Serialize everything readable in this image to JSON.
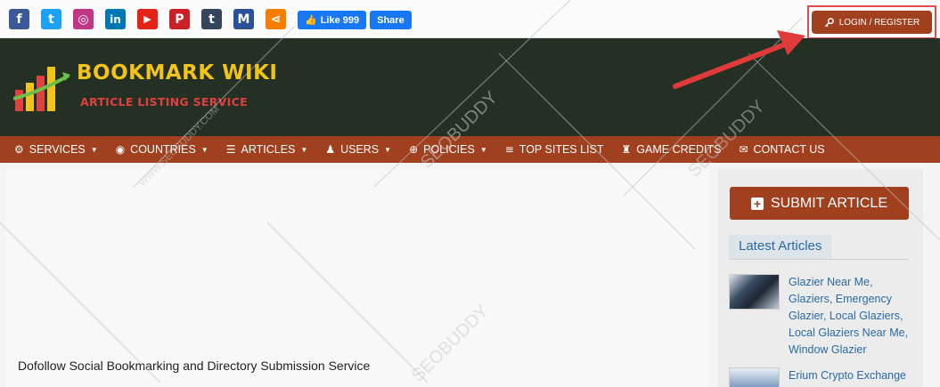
{
  "social_icons": [
    {
      "name": "facebook-icon",
      "glyph": "f",
      "color": "#3b5998"
    },
    {
      "name": "twitter-icon",
      "glyph": "t",
      "color": "#1da1f2"
    },
    {
      "name": "instagram-icon",
      "glyph": "◎",
      "color": "#c13584"
    },
    {
      "name": "linkedin-icon",
      "glyph": "in",
      "color": "#0077b5"
    },
    {
      "name": "youtube-icon",
      "glyph": "▶",
      "color": "#e62117"
    },
    {
      "name": "pinterest-icon",
      "glyph": "P",
      "color": "#cb2027"
    },
    {
      "name": "tumblr-icon",
      "glyph": "t",
      "color": "#35465c"
    },
    {
      "name": "medium-icon",
      "glyph": "M",
      "color": "#2a5298"
    },
    {
      "name": "share-icon",
      "glyph": "⋖",
      "color": "#f57d00"
    }
  ],
  "fb": {
    "like_label": "Like 999",
    "share_label": "Share"
  },
  "login": {
    "label": "LOGIN / REGISTER"
  },
  "logo": {
    "title": "BOOKMARK WIKI",
    "subtitle": "ARTICLE LISTING SERVICE"
  },
  "nav": [
    {
      "label": "SERVICES",
      "icon": "⚙",
      "caret": true
    },
    {
      "label": "COUNTRIES",
      "icon": "◉",
      "caret": true
    },
    {
      "label": "ARTICLES",
      "icon": "☰",
      "caret": true
    },
    {
      "label": "USERS",
      "icon": "♟",
      "caret": true
    },
    {
      "label": "POLICIES",
      "icon": "⊕",
      "caret": true
    },
    {
      "label": "TOP SITES LIST",
      "icon": "≡",
      "caret": false
    },
    {
      "label": "GAME CREDITS",
      "icon": "♜",
      "caret": false
    },
    {
      "label": "CONTACT US",
      "icon": "✉",
      "caret": false
    }
  ],
  "main": {
    "tagline": "Dofollow Social Bookmarking and Directory Submission Service"
  },
  "sidebar": {
    "submit_label": "SUBMIT ARTICLE",
    "latest_heading": "Latest Articles",
    "articles": [
      {
        "title": "Glazier Near Me, Glaziers, Emergency Glazier, Local Glaziers, Local Glaziers Near Me, Window Glazier"
      },
      {
        "title": "Erium Crypto Exchange"
      }
    ]
  },
  "watermark": {
    "text": "SEOBUDDY",
    "url": "WWW.SEOBUDDY.COM"
  },
  "colors": {
    "brand": "#a0401f",
    "header_bg": "#243024",
    "logo_yellow": "#f2c318",
    "link": "#2a6aa5"
  }
}
